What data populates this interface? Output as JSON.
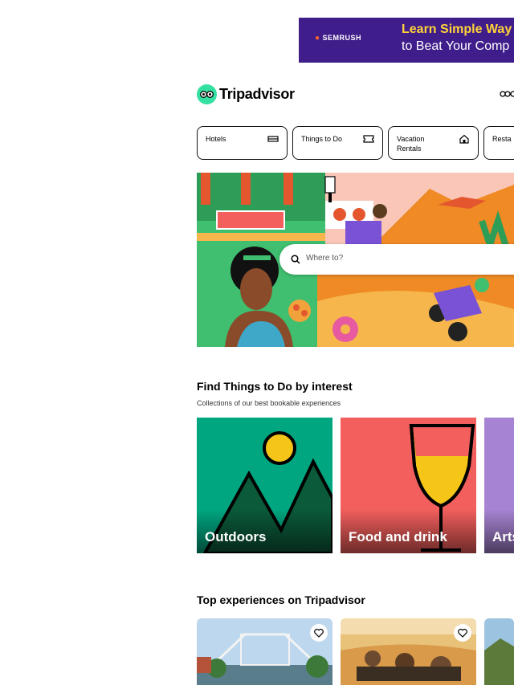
{
  "ad": {
    "brand": "SEMRUSH",
    "line1": "Learn Simple Way",
    "line2": "to Beat Your Comp",
    "colors": {
      "background": "#3f1d8a",
      "headline": "#ffd438"
    }
  },
  "header": {
    "logo_text": "Tripadvisor",
    "logo_icon": "owl-eyes-icon",
    "brand_color": "#34e0a1"
  },
  "tabs": [
    {
      "label": "Hotels",
      "icon": "bed-icon"
    },
    {
      "label": "Things to Do",
      "icon": "ticket-icon"
    },
    {
      "label": "Vacation Rentals",
      "icon": "house-icon"
    },
    {
      "label": "Resta",
      "icon": "restaurant-icon"
    }
  ],
  "hero": {
    "search_placeholder": "Where to?"
  },
  "things_to_do": {
    "title": "Find Things to Do by interest",
    "subtitle": "Collections of our best bookable experiences",
    "cards": [
      {
        "label": "Outdoors",
        "color": "#00a680"
      },
      {
        "label": "Food and drink",
        "color": "#f25f5c"
      },
      {
        "label": "Arts",
        "color": "#a784d3"
      }
    ]
  },
  "top_experiences": {
    "title": "Top experiences on Tripadvisor"
  }
}
